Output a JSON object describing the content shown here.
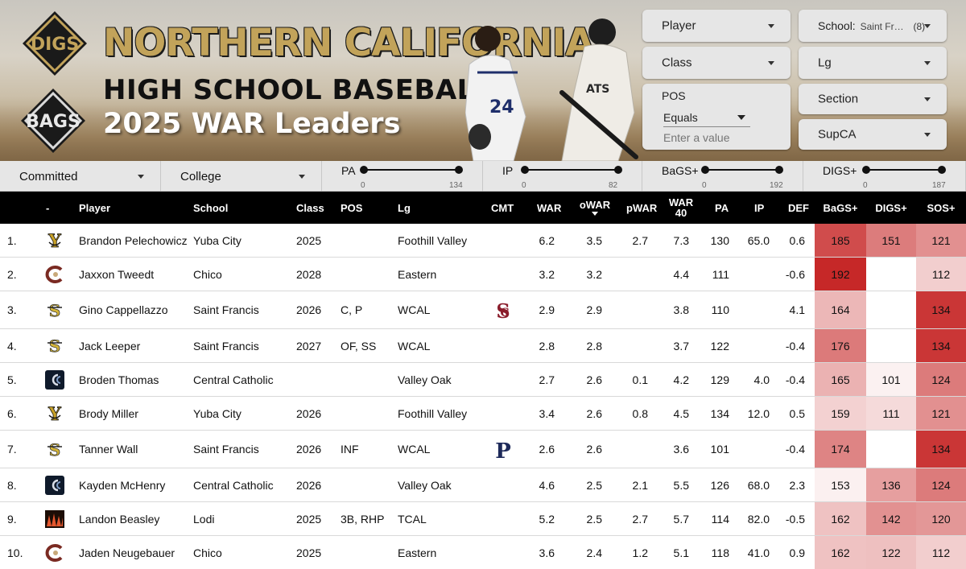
{
  "header": {
    "logo_top_text": "DIGS",
    "logo_bottom_text": "BAGS",
    "title_line1": "NORTHERN CALIFORNIA",
    "title_line2": "HIGH SCHOOL BASEBALL",
    "title_line3": "2025 WAR Leaders"
  },
  "filters": {
    "player_label": "Player",
    "school_label": "School:",
    "school_value": "Saint Fr…",
    "school_count": "(8)",
    "class_label": "Class",
    "lg_label": "Lg",
    "pos_label": "POS",
    "pos_operator": "Equals",
    "pos_placeholder": "Enter a value",
    "section_label": "Section",
    "supca_label": "SupCA",
    "committed_label": "Committed",
    "college_label": "College"
  },
  "sliders": [
    {
      "label": "PA",
      "min": "0",
      "max": "134",
      "low": 0,
      "high": 1
    },
    {
      "label": "IP",
      "min": "0",
      "max": "82",
      "low": 0,
      "high": 1
    },
    {
      "label": "BaGS+",
      "min": "0",
      "max": "192",
      "low": 0,
      "high": 1
    },
    {
      "label": "DIGS+",
      "min": "0",
      "max": "187",
      "low": 0,
      "high": 1
    }
  ],
  "columns": {
    "rank": "-",
    "player": "Player",
    "school": "School",
    "class": "Class",
    "pos": "POS",
    "lg": "Lg",
    "cmt": "CMT",
    "war": "WAR",
    "owar": "oWAR",
    "pwar": "pWAR",
    "war40_top": "WAR",
    "war40_bottom": "40",
    "pa": "PA",
    "ip": "IP",
    "def": "DEF",
    "bags": "BaGS+",
    "digs": "DIGS+",
    "sos": "SOS+"
  },
  "colors": {
    "heat_base": "#c62828",
    "header_bg": "#000000",
    "title_gold": "#c2a35a"
  },
  "rows": [
    {
      "rank": "1.",
      "logo": "yuba-city-logo",
      "player": "Brandon Pelechowicz",
      "school": "Yuba City",
      "class": "2025",
      "pos": "",
      "lg": "Foothill Valley",
      "cmt": "",
      "war": "6.2",
      "owar": "3.5",
      "pwar": "2.7",
      "war40": "7.3",
      "pa": "130",
      "ip": "65.0",
      "def": "0.6",
      "bags": "185",
      "digs": "151",
      "sos": "121"
    },
    {
      "rank": "2.",
      "logo": "chico-logo",
      "player": "Jaxxon Tweedt",
      "school": "Chico",
      "class": "2028",
      "pos": "",
      "lg": "Eastern",
      "cmt": "",
      "war": "3.2",
      "owar": "3.2",
      "pwar": "",
      "war40": "4.4",
      "pa": "111",
      "ip": "",
      "def": "-0.6",
      "bags": "192",
      "digs": "",
      "sos": "112"
    },
    {
      "rank": "3.",
      "logo": "saint-francis-logo",
      "player": "Gino Cappellazzo",
      "school": "Saint Francis",
      "class": "2026",
      "pos": "C, P",
      "lg": "WCAL",
      "cmt": "santa-clara-logo",
      "war": "2.9",
      "owar": "2.9",
      "pwar": "",
      "war40": "3.8",
      "pa": "110",
      "ip": "",
      "def": "4.1",
      "bags": "164",
      "digs": "",
      "sos": "134"
    },
    {
      "rank": "4.",
      "logo": "saint-francis-logo",
      "player": "Jack Leeper",
      "school": "Saint Francis",
      "class": "2027",
      "pos": "OF, SS",
      "lg": "WCAL",
      "cmt": "",
      "war": "2.8",
      "owar": "2.8",
      "pwar": "",
      "war40": "3.7",
      "pa": "122",
      "ip": "",
      "def": "-0.4",
      "bags": "176",
      "digs": "",
      "sos": "134"
    },
    {
      "rank": "5.",
      "logo": "central-catholic-logo",
      "player": "Broden Thomas",
      "school": "Central Catholic",
      "class": "",
      "pos": "",
      "lg": "Valley Oak",
      "cmt": "",
      "war": "2.7",
      "owar": "2.6",
      "pwar": "0.1",
      "war40": "4.2",
      "pa": "129",
      "ip": "4.0",
      "def": "-0.4",
      "bags": "165",
      "digs": "101",
      "sos": "124"
    },
    {
      "rank": "6.",
      "logo": "yuba-city-logo",
      "player": "Brody Miller",
      "school": "Yuba City",
      "class": "2026",
      "pos": "",
      "lg": "Foothill Valley",
      "cmt": "",
      "war": "3.4",
      "owar": "2.6",
      "pwar": "0.8",
      "war40": "4.5",
      "pa": "134",
      "ip": "12.0",
      "def": "0.5",
      "bags": "159",
      "digs": "111",
      "sos": "121"
    },
    {
      "rank": "7.",
      "logo": "saint-francis-logo",
      "player": "Tanner Wall",
      "school": "Saint Francis",
      "class": "2026",
      "pos": "INF",
      "lg": "WCAL",
      "cmt": "pepperdine-logo",
      "war": "2.6",
      "owar": "2.6",
      "pwar": "",
      "war40": "3.6",
      "pa": "101",
      "ip": "",
      "def": "-0.4",
      "bags": "174",
      "digs": "",
      "sos": "134"
    },
    {
      "rank": "8.",
      "logo": "central-catholic-logo",
      "player": "Kayden McHenry",
      "school": "Central Catholic",
      "class": "2026",
      "pos": "",
      "lg": "Valley Oak",
      "cmt": "",
      "war": "4.6",
      "owar": "2.5",
      "pwar": "2.1",
      "war40": "5.5",
      "pa": "126",
      "ip": "68.0",
      "def": "2.3",
      "bags": "153",
      "digs": "136",
      "sos": "124"
    },
    {
      "rank": "9.",
      "logo": "lodi-logo",
      "player": "Landon Beasley",
      "school": "Lodi",
      "class": "2025",
      "pos": "3B, RHP",
      "lg": "TCAL",
      "cmt": "",
      "war": "5.2",
      "owar": "2.5",
      "pwar": "2.7",
      "war40": "5.7",
      "pa": "114",
      "ip": "82.0",
      "def": "-0.5",
      "bags": "162",
      "digs": "142",
      "sos": "120"
    },
    {
      "rank": "10.",
      "logo": "chico-logo",
      "player": "Jaden Neugebauer",
      "school": "Chico",
      "class": "2025",
      "pos": "",
      "lg": "Eastern",
      "cmt": "",
      "war": "3.6",
      "owar": "2.4",
      "pwar": "1.2",
      "war40": "5.1",
      "pa": "118",
      "ip": "41.0",
      "def": "0.9",
      "bags": "162",
      "digs": "122",
      "sos": "112"
    }
  ]
}
